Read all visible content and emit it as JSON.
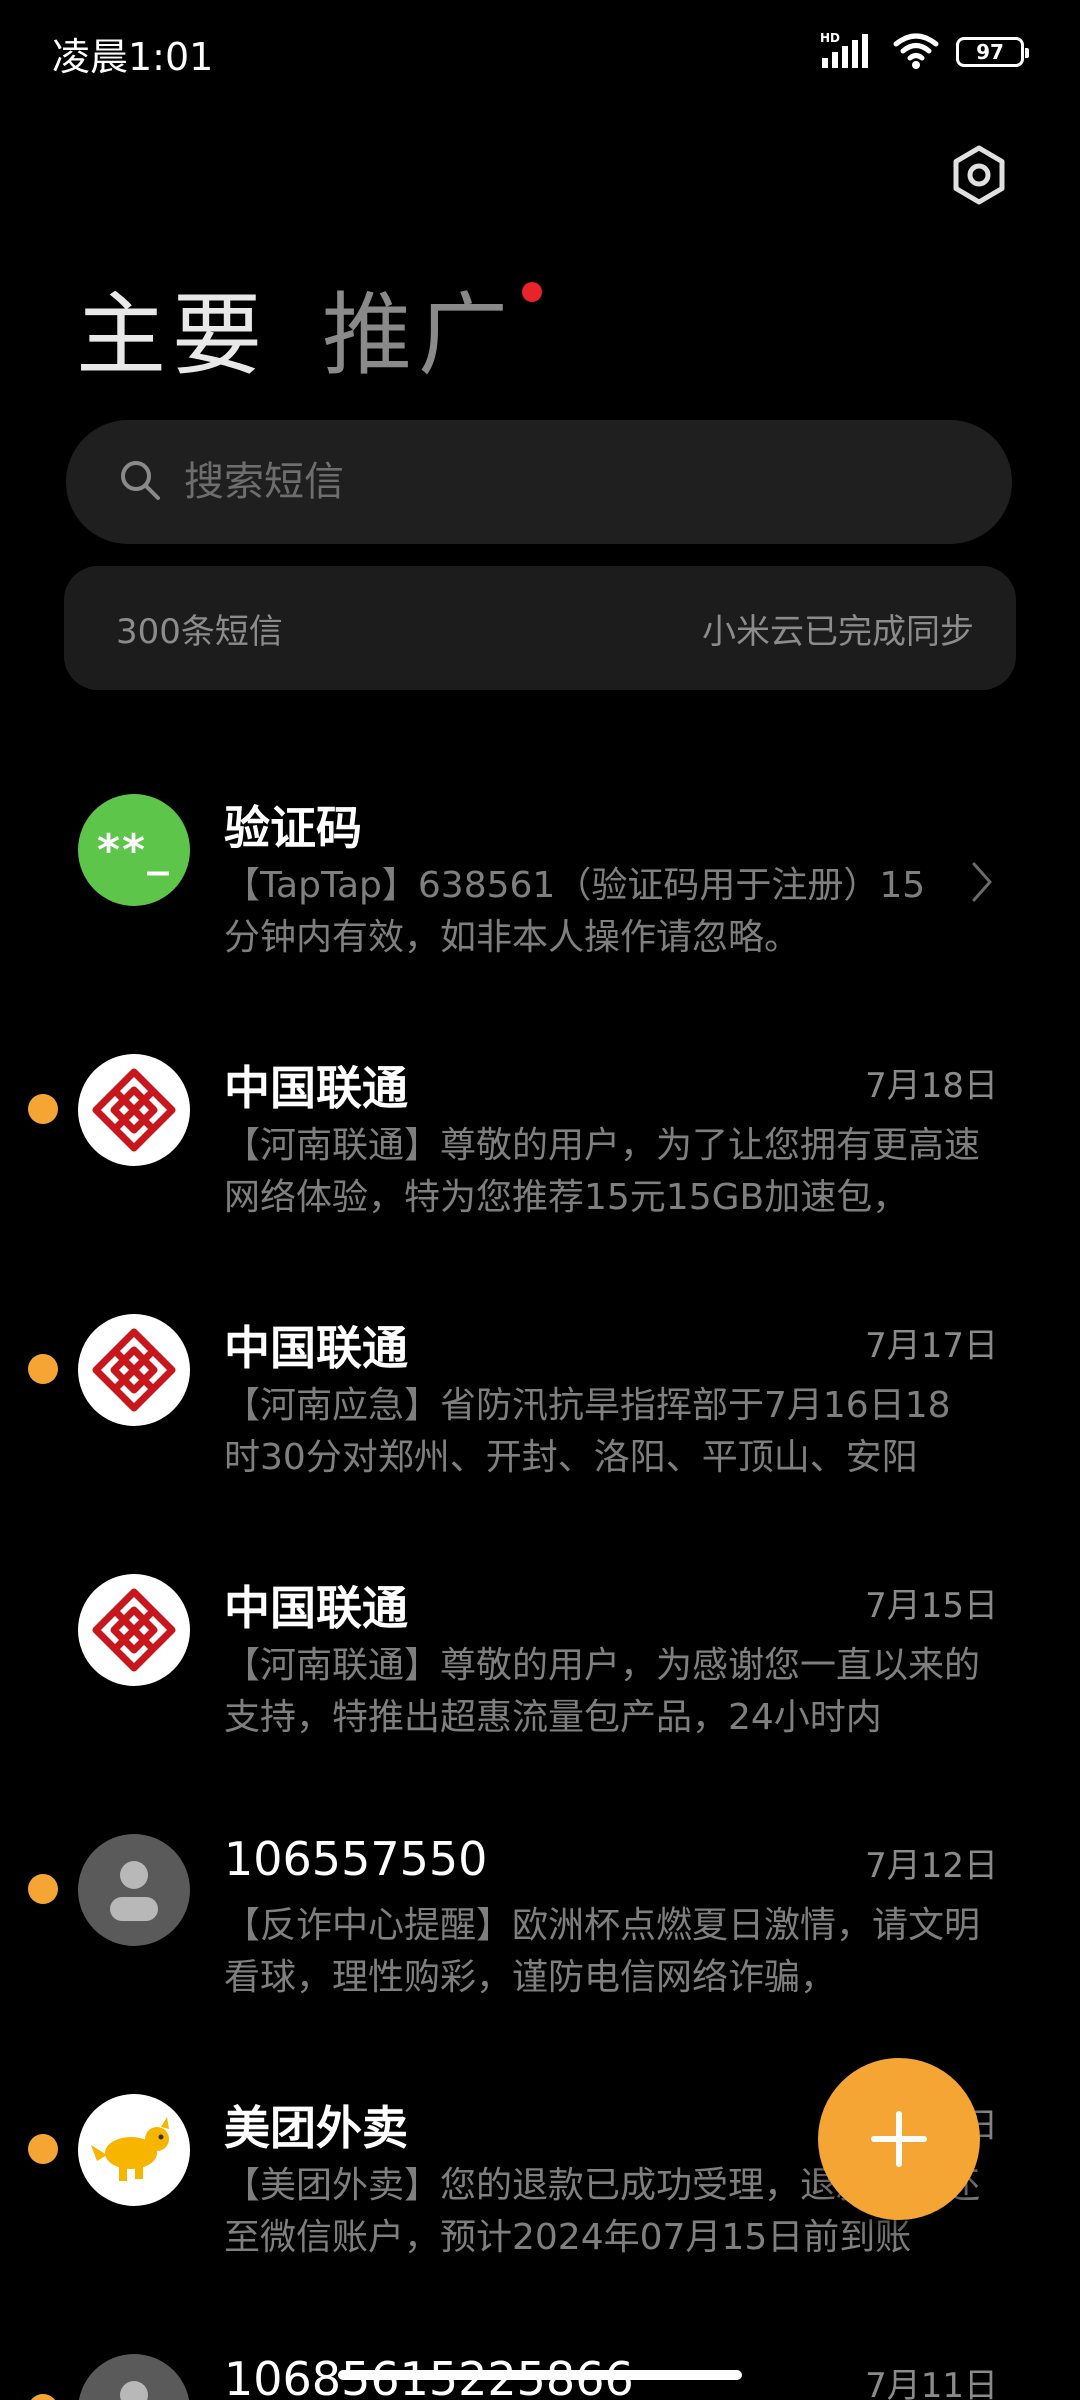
{
  "status_bar": {
    "time": "凌晨1:01",
    "network_label": "HD",
    "battery": "97"
  },
  "tabs": [
    {
      "label": "主要",
      "active": true
    },
    {
      "label": "推广",
      "active": false,
      "has_dot": true
    }
  ],
  "search": {
    "placeholder": "搜索短信"
  },
  "info": {
    "count_text": "300条短信",
    "sync_text": "小米云已完成同步"
  },
  "messages": [
    {
      "sender": "验证码",
      "date": "",
      "preview": "【TapTap】638561（验证码用于注册）15分钟内有效，如非本人操作请忽略。",
      "avatar": "verification-code-icon",
      "avatar_text": "**_",
      "unread": false
    },
    {
      "sender": "中国联通",
      "date": "7月18日",
      "preview": "【河南联通】尊敬的用户，为了让您拥有更高速网络体验，特为您推荐15元15GB加速包，",
      "avatar": "china-unicom-logo",
      "unread": true
    },
    {
      "sender": "中国联通",
      "date": "7月17日",
      "preview": "【河南应急】省防汛抗旱指挥部于7月16日18时30分对郑州、开封、洛阳、平顶山、安阳",
      "avatar": "china-unicom-logo",
      "unread": true
    },
    {
      "sender": "中国联通",
      "date": "7月15日",
      "preview": "【河南联通】尊敬的用户，为感谢您一直以来的支持，特推出超惠流量包产品，24小时内",
      "avatar": "china-unicom-logo",
      "unread": false
    },
    {
      "sender": "106557550",
      "date": "7月12日",
      "preview": "【反诈中心提醒】欧洲杯点燃夏日激情，请文明看球，理性购彩，谨防电信网络诈骗，",
      "avatar": "person-icon",
      "unread": true
    },
    {
      "sender": "美团外卖",
      "date": "7月12日",
      "preview": "【美团外卖】您的退款已成功受理，退款将退还至微信账户，预计2024年07月15日前到账",
      "avatar": "meituan-kangaroo-logo",
      "unread": true
    },
    {
      "sender": "10685615225866",
      "date": "7月11日",
      "preview": "",
      "avatar": "person-icon",
      "unread": true
    }
  ],
  "colors": {
    "accent": "#f5a534",
    "badge_red": "#e8232a",
    "verification_green": "#5cc54a",
    "unicom_red": "#c8161d"
  }
}
